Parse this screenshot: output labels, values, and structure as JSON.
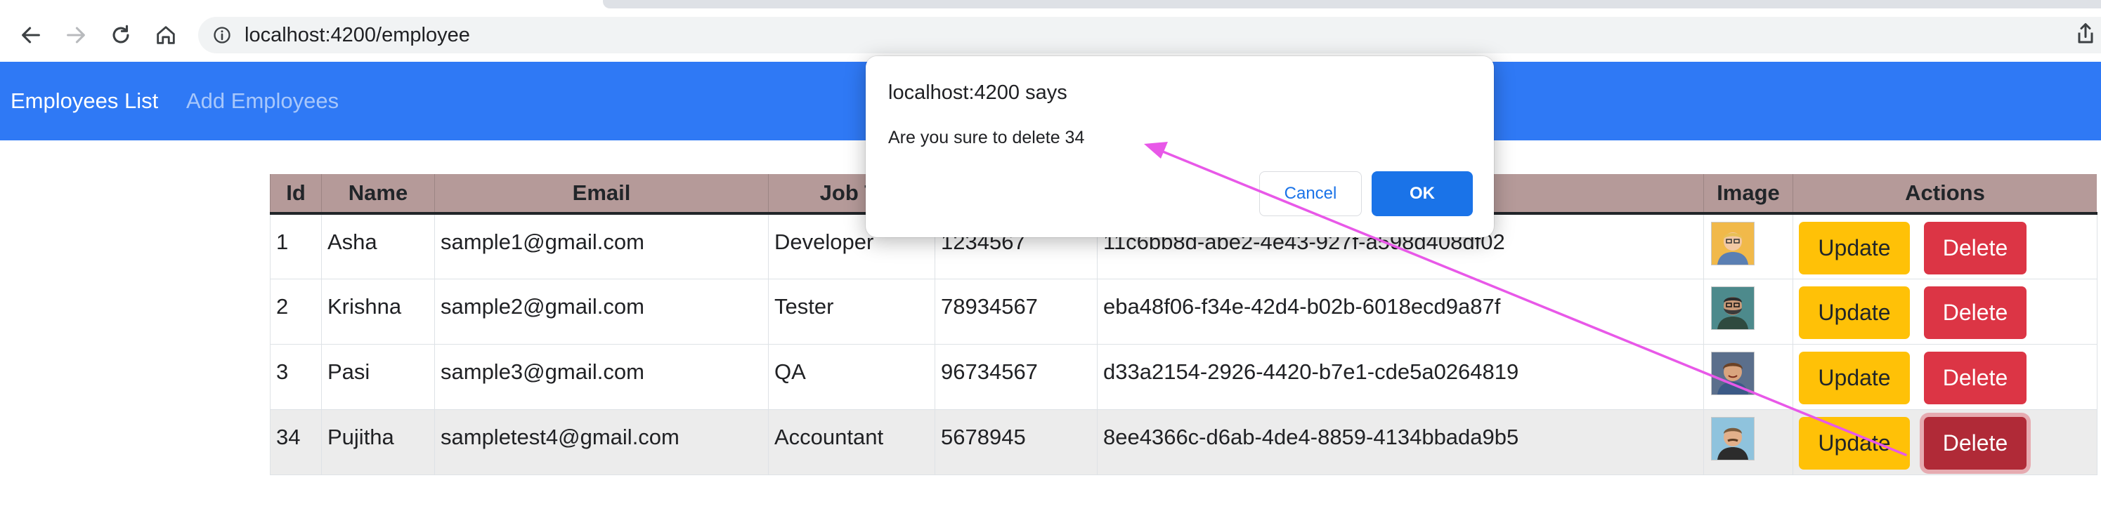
{
  "browser": {
    "url": "localhost:4200/employee",
    "icons": [
      "back-arrow-icon",
      "forward-arrow-icon",
      "reload-icon",
      "home-icon",
      "info-icon",
      "share-icon"
    ]
  },
  "navbar": {
    "links": [
      {
        "label": "Employees List",
        "active": true
      },
      {
        "label": "Add Employees",
        "active": false
      }
    ],
    "color": "#2f79f5"
  },
  "table": {
    "headers": [
      "Id",
      "Name",
      "Email",
      "Job Ti",
      "",
      "",
      "Image",
      "Actions"
    ],
    "update_label": "Update",
    "delete_label": "Delete",
    "rows": [
      {
        "id": "1",
        "name": "Asha",
        "email": "sample1@gmail.com",
        "job": "Developer",
        "phone": "1234567",
        "code": "11c6bb8d-abe2-4e43-927f-a598d408df02",
        "avatar": "blond-man-avatar"
      },
      {
        "id": "2",
        "name": "Krishna",
        "email": "sample2@gmail.com",
        "job": "Tester",
        "phone": "78934567",
        "code": "eba48f06-f34e-42d4-b02b-6018ecd9a87f",
        "avatar": "bearded-man-avatar"
      },
      {
        "id": "3",
        "name": "Pasi",
        "email": "sample3@gmail.com",
        "job": "QA",
        "phone": "96734567",
        "code": "d33a2154-2926-4420-b7e1-cde5a0264819",
        "avatar": "smiling-man-avatar"
      },
      {
        "id": "34",
        "name": "Pujitha",
        "email": "sampletest4@gmail.com",
        "job": "Accountant",
        "phone": "5678945",
        "code": "8ee4366c-d6ab-4de4-8859-4134bbada9b5",
        "avatar": "mustache-man-avatar"
      }
    ],
    "header_color": "#b59a99",
    "update_color": "#ffc107",
    "delete_color": "#dc3545"
  },
  "dialog": {
    "title": "localhost:4200 says",
    "message": "Are you sure to delete 34",
    "cancel_label": "Cancel",
    "ok_label": "OK"
  },
  "annotation": {
    "color": "#e858e8"
  }
}
